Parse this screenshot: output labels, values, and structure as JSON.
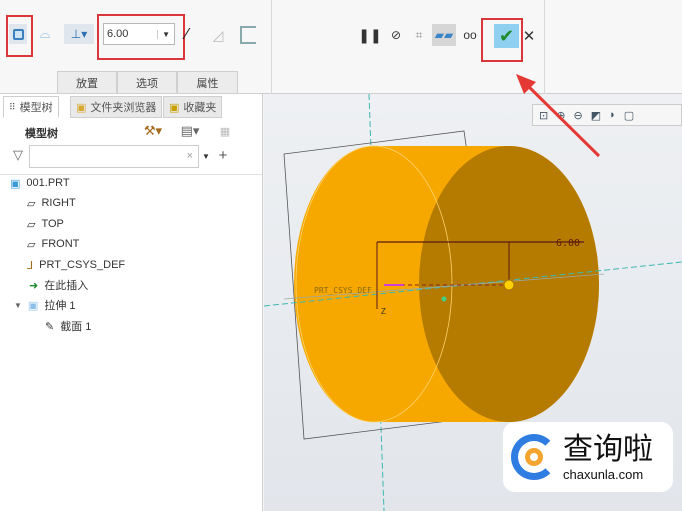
{
  "ribbon": {
    "depth_value": "6.00",
    "dashboard_tabs": [
      "放置",
      "选项",
      "属性"
    ],
    "icons": [
      "solid-icon",
      "surface-icon",
      "depth-option-icon",
      "flip-direction-icon",
      "remove-material-icon",
      "thicken-icon",
      "pause-icon",
      "no-preview-icon",
      "preview-icon",
      "verify-preview-icon",
      "glasses-preview-icon",
      "ok-checkmark-icon",
      "cancel-icon"
    ]
  },
  "panel": {
    "tabs": [
      "模型树",
      "文件夹浏览器",
      "收藏夹"
    ],
    "header": "模型树",
    "search_placeholder": "",
    "tree": [
      {
        "label": "001.PRT",
        "icon": "part-icon"
      },
      {
        "label": "RIGHT",
        "icon": "datum-plane-icon"
      },
      {
        "label": "TOP",
        "icon": "datum-plane-icon"
      },
      {
        "label": "FRONT",
        "icon": "datum-plane-icon"
      },
      {
        "label": "PRT_CSYS_DEF",
        "icon": "csys-icon"
      },
      {
        "label": "在此插入",
        "icon": "insert-here-arrow-icon"
      },
      {
        "label": "拉伸 1",
        "icon": "extrude-icon"
      },
      {
        "label": "截面 1",
        "icon": "sketch-icon"
      }
    ]
  },
  "viewport": {
    "dimension": "6.00",
    "csys_label": "PRT_CSYS_DEF",
    "axis_z": "Z",
    "colors": {
      "body": "#f6a800",
      "front": "#b57a00"
    }
  },
  "watermark": {
    "text": "查询啦",
    "url": "chaxunla.com"
  }
}
